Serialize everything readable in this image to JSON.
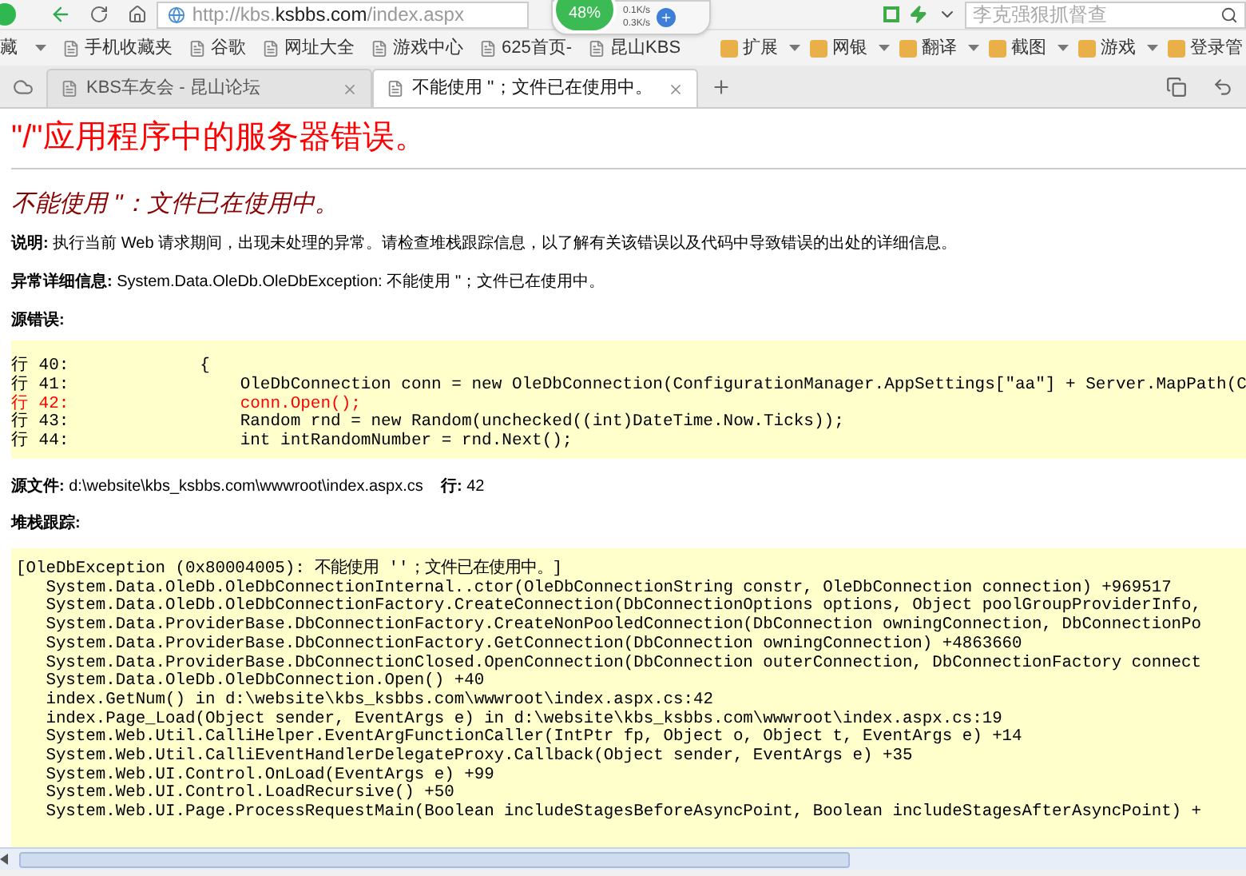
{
  "toolbar": {
    "url_prefix": "http://kbs.",
    "url_domain": "ksbbs.com",
    "url_path": "/index.aspx",
    "search": {
      "placeholder": "李克强狠抓督查"
    }
  },
  "speed_widget": {
    "percent": "48%",
    "upload": "0.1K/s",
    "download": "0.3K/s"
  },
  "bookmarks_left": [
    {
      "label": "藏",
      "dropdown": true
    },
    {
      "label": "手机收藏夹",
      "dropdown": false
    },
    {
      "label": "谷歌",
      "dropdown": false
    },
    {
      "label": "网址大全",
      "dropdown": false
    },
    {
      "label": "游戏中心",
      "dropdown": false
    },
    {
      "label": "625首页-",
      "dropdown": false
    },
    {
      "label": "昆山KBS",
      "dropdown": false
    }
  ],
  "bookmarks_right": [
    {
      "label": "扩展",
      "dropdown": true
    },
    {
      "label": "网银",
      "dropdown": true
    },
    {
      "label": "翻译",
      "dropdown": true
    },
    {
      "label": "截图",
      "dropdown": true
    },
    {
      "label": "游戏",
      "dropdown": true
    },
    {
      "label": "登录管",
      "dropdown": false
    }
  ],
  "tabs": [
    {
      "label": "KBS车友会 - 昆山论坛",
      "selected": false
    },
    {
      "label": "不能使用 ''；文件已在使用中。",
      "selected": true
    }
  ],
  "page": {
    "title": "\"/\"应用程序中的服务器错误。",
    "error_heading": "不能使用 ''：文件已在使用中。",
    "description": "**说明:** 执行当前 Web 请求期间，出现未处理的异常。请检查堆栈跟踪信息，以了解有关该错误以及代码中导致错误的出处的详细信息。",
    "exception_details": "**异常详细信息:** System.Data.OleDb.OleDbException: 不能使用 ''；文件已在使用中。",
    "source_error_label": "源错误:",
    "source_lines": [
      {
        "number": "行 40:",
        "code": "        {",
        "highlighted": false
      },
      {
        "number": "行 41:",
        "code": "            OleDbConnection conn = new OleDbConnection(ConfigurationManager.AppSettings[\"aa\"] + Server.MapPath(C",
        "highlighted": false
      },
      {
        "number": "行 42:",
        "code": "            conn.Open();",
        "highlighted": true
      },
      {
        "number": "行 43:",
        "code": "            Random rnd = new Random(unchecked((int)DateTime.Now.Ticks));",
        "highlighted": false
      },
      {
        "number": "行 44:",
        "code": "            int intRandomNumber = rnd.Next();",
        "highlighted": false
      }
    ],
    "source_file": "**源文件:** d:\\website\\kbs_ksbbs.com\\wwwroot\\index.aspx.cs    **行:** 42",
    "stack_trace_label": "堆栈跟踪:",
    "stack_trace": [
      "[OleDbException (0x80004005): 不能使用 ''；文件已在使用中。]",
      "   System.Data.OleDb.OleDbConnectionInternal..ctor(OleDbConnectionString constr, OleDbConnection connection) +969517",
      "   System.Data.OleDb.OleDbConnectionFactory.CreateConnection(DbConnectionOptions options, Object poolGroupProviderInfo,",
      "   System.Data.ProviderBase.DbConnectionFactory.CreateNonPooledConnection(DbConnection owningConnection, DbConnectionPo",
      "   System.Data.ProviderBase.DbConnectionFactory.GetConnection(DbConnection owningConnection) +4863660",
      "   System.Data.ProviderBase.DbConnectionClosed.OpenConnection(DbConnection outerConnection, DbConnectionFactory connect",
      "   System.Data.OleDb.OleDbConnection.Open() +40",
      "   index.GetNum() in d:\\website\\kbs_ksbbs.com\\wwwroot\\index.aspx.cs:42",
      "   index.Page_Load(Object sender, EventArgs e) in d:\\website\\kbs_ksbbs.com\\wwwroot\\index.aspx.cs:19",
      "   System.Web.Util.CalliHelper.EventArgFunctionCaller(IntPtr fp, Object o, Object t, EventArgs e) +14",
      "   System.Web.Util.CalliEventHandlerDelegateProxy.Callback(Object sender, EventArgs e) +35",
      "   System.Web.UI.Control.OnLoad(EventArgs e) +99",
      "   System.Web.UI.Control.LoadRecursive() +50",
      "   System.Web.UI.Page.ProcessRequestMain(Boolean includeStagesBeforeAsyncPoint, Boolean includeStagesAfterAsyncPoint) +"
    ]
  }
}
